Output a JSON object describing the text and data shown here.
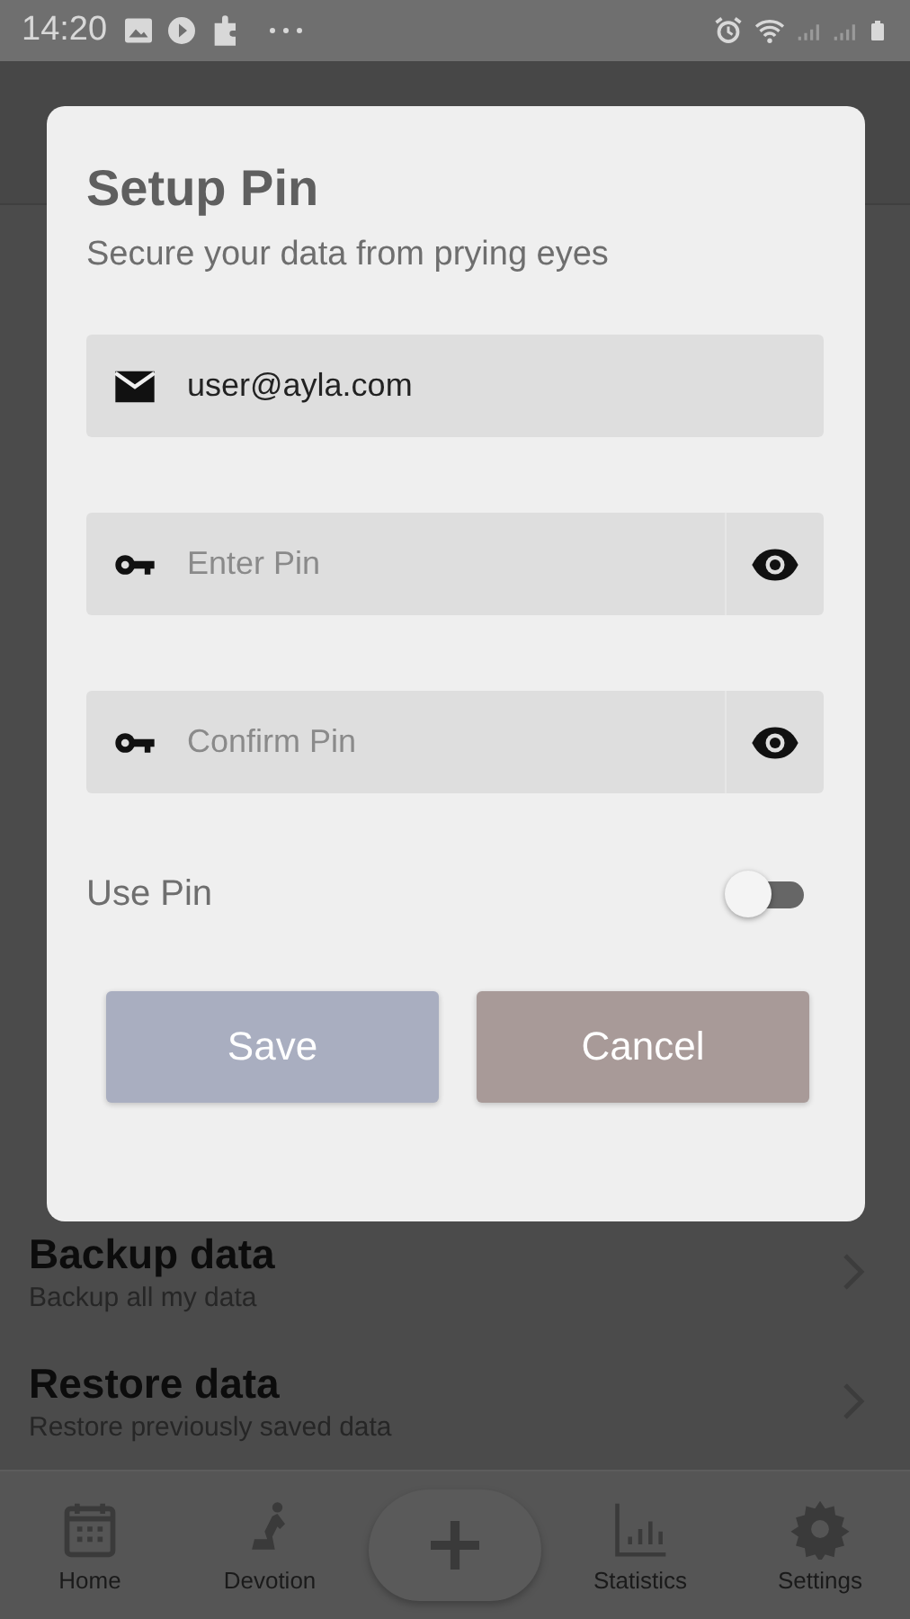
{
  "status_bar": {
    "time": "14:20"
  },
  "background_list": [
    {
      "kind": "row",
      "title": "Backup data",
      "subtitle": "Backup all my data"
    },
    {
      "kind": "row",
      "title": "Restore data",
      "subtitle": "Restore previously saved data"
    }
  ],
  "dialog": {
    "title": "Setup Pin",
    "subtitle": "Secure your data from prying eyes",
    "fields": [
      {
        "kind": "email",
        "value": "user@ayla.com"
      },
      {
        "kind": "pin",
        "placeholder": "Enter Pin"
      },
      {
        "kind": "pin",
        "placeholder": "Confirm Pin"
      }
    ],
    "toggle": {
      "label": "Use Pin",
      "on": false
    },
    "buttons": [
      {
        "label": "Save",
        "disabled": true
      },
      {
        "label": "Cancel",
        "disabled": false
      }
    ]
  },
  "bottom_nav": [
    {
      "kind": "home",
      "label": "Home"
    },
    {
      "kind": "devotion",
      "label": "Devotion"
    },
    {
      "kind": "add"
    },
    {
      "kind": "statistics",
      "label": "Statistics"
    },
    {
      "kind": "settings",
      "label": "Settings"
    }
  ]
}
